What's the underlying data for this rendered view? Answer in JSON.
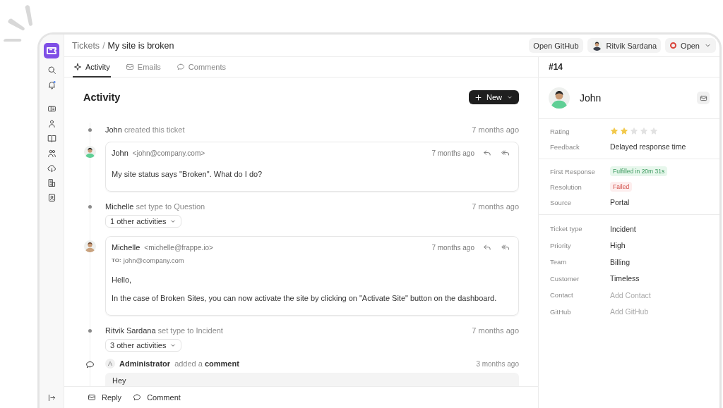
{
  "breadcrumb": {
    "parent": "Tickets",
    "separator": "/",
    "current": "My site is broken"
  },
  "header_actions": {
    "github_button": "Open GitHub",
    "assignee": "Ritvik Sardana",
    "status": {
      "label": "Open",
      "color": "#d9433a"
    }
  },
  "tabs": [
    {
      "label": "Activity",
      "kind": "activity",
      "selected": true
    },
    {
      "label": "Emails",
      "kind": "emails",
      "selected": false
    },
    {
      "label": "Comments",
      "kind": "comments",
      "selected": false
    }
  ],
  "activity": {
    "heading": "Activity",
    "new_button": "New",
    "items": [
      {
        "kind": "event",
        "actor": "John",
        "action": "created this ticket",
        "time": "7 months ago"
      },
      {
        "kind": "email",
        "sender": "John",
        "address": "<john@company.com>",
        "time": "7 months ago",
        "body": [
          "My site status says \"Broken\". What do I do?"
        ]
      },
      {
        "kind": "event",
        "actor": "Michelle",
        "action": "set type to Question",
        "time": "7 months ago",
        "more": "1 other activities"
      },
      {
        "kind": "email",
        "sender": "Michelle",
        "address": "<michelle@frappe.io>",
        "to_label": "TO:",
        "to": "john@company.com",
        "time": "7 months ago",
        "body": [
          "Hello,",
          "In the case of Broken Sites, you can now activate the site by clicking on \"Activate Site\" button on the dashboard."
        ]
      },
      {
        "kind": "event",
        "actor": "Ritvik Sardana",
        "action": "set type to Incident",
        "time": "7 months ago",
        "more": "3 other activities"
      },
      {
        "kind": "comment",
        "initial": "A",
        "actor": "Administrator",
        "action": "added a **comment**",
        "time": "3 months ago",
        "body": "Hey"
      }
    ]
  },
  "composer": [
    {
      "label": "Reply",
      "kind": "reply"
    },
    {
      "label": "Comment",
      "kind": "comment"
    }
  ],
  "details": {
    "ticket_id": "#14",
    "contact": "John",
    "rating": {
      "label": "Rating",
      "stars": 2
    },
    "feedback": {
      "label": "Feedback",
      "value": "Delayed response time"
    },
    "sla": [
      {
        "label": "First Response",
        "value": "Fulfilled in 20m 31s",
        "kind": "success"
      },
      {
        "label": "Resolution",
        "value": "Failed",
        "kind": "failed"
      },
      {
        "label": "Source",
        "value": "Portal",
        "kind": "text"
      }
    ],
    "fields": [
      {
        "label": "Ticket type",
        "value": "Incident",
        "kind": "text"
      },
      {
        "label": "Priority",
        "value": "High",
        "kind": "text"
      },
      {
        "label": "Team",
        "value": "Billing",
        "kind": "text"
      },
      {
        "label": "Customer",
        "value": "Timeless",
        "kind": "text"
      },
      {
        "label": "Contact",
        "placeholder": "Add Contact",
        "kind": "input"
      },
      {
        "label": "GitHub",
        "placeholder": "Add GitHub",
        "kind": "input"
      }
    ]
  }
}
